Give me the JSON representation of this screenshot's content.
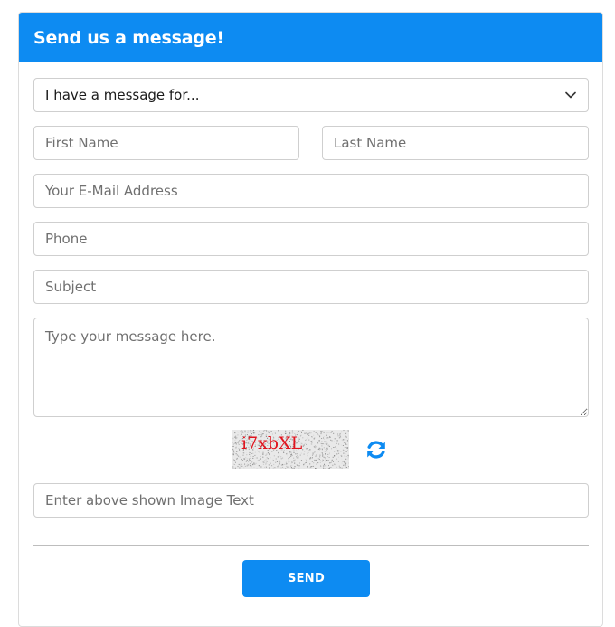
{
  "form": {
    "title": "Send us a message!",
    "recipient_select": {
      "selected": "I have a message for..."
    },
    "first_name": {
      "placeholder": "First Name"
    },
    "last_name": {
      "placeholder": "Last Name"
    },
    "email": {
      "placeholder": "Your E-Mail Address"
    },
    "phone": {
      "placeholder": "Phone"
    },
    "subject": {
      "placeholder": "Subject"
    },
    "message": {
      "placeholder": "Type your message here."
    },
    "captcha": {
      "image_text": "i7xbXL",
      "refresh_icon": "refresh-icon",
      "input_placeholder": "Enter above shown Image Text"
    },
    "send_label": "SEND"
  },
  "colors": {
    "accent": "#0d8bf2",
    "captcha_text": "#e0141e"
  }
}
